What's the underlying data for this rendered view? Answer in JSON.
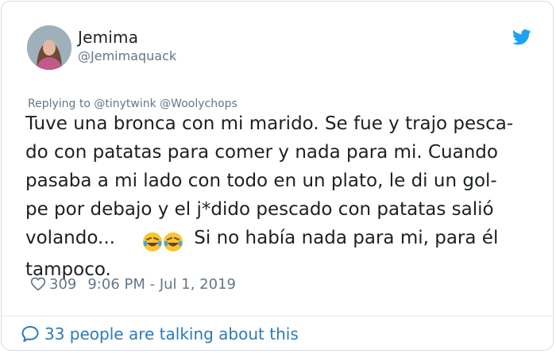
{
  "author": {
    "name": "Jemima",
    "handle": "@Jemimaquack"
  },
  "replying_to": "Replying to @tinytwink @Woolychops",
  "tweet": {
    "text_before_emoji": "Tuve una bronca con mi marido. Se fue y trajo pesca-\ndo con patatas para comer y nada para mi. Cuando\npasaba a mi lado con todo en un plato, le di un gol-\npe por debajo y el j*dido pescado con patatas salió\nvolando...",
    "emoji": "🤣🤣",
    "text_after_emoji": " Si no había nada para mi, para él\ntampoco."
  },
  "meta": {
    "likes": "309",
    "timestamp": "9:06 PM - Jul 1, 2019"
  },
  "footer": {
    "talking": "33 people are talking about this"
  },
  "icons": {
    "twitter": "twitter-bird-icon",
    "heart": "heart-icon",
    "speech": "speech-bubble-icon"
  },
  "colors": {
    "twitter_blue": "#1da1f2",
    "link_blue": "#2b7bb9",
    "secondary_text": "#657786",
    "primary_text": "#1c2022"
  }
}
